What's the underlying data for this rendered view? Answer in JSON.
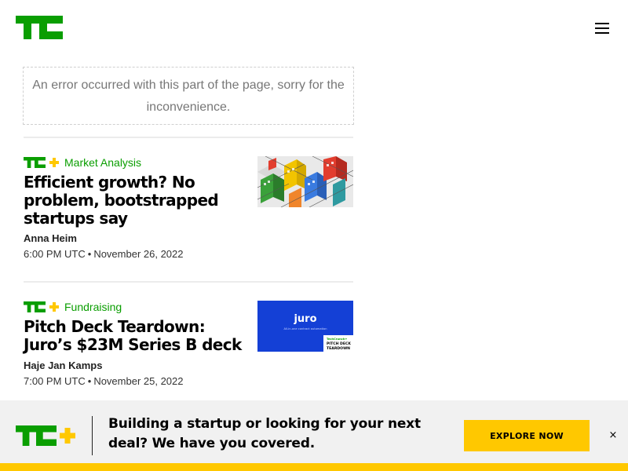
{
  "header": {
    "logo_text": "TC",
    "menu_icon": "hamburger-menu-icon"
  },
  "error_message": "An error occurred with this part of the page, sorry for the inconvenience.",
  "articles": [
    {
      "category": "Market Analysis",
      "title": "Efficient growth? No problem, bootstrapped startups say",
      "author": "Anna Heim",
      "time": "6:00 PM UTC",
      "separator": "•",
      "date": "November 26, 2022"
    },
    {
      "category": "Fundraising",
      "title": "Pitch Deck Teardown: Juro’s $23M Series B deck",
      "author": "Haje Jan Kamps",
      "time": "7:00 PM UTC",
      "separator": "•",
      "date": "November 25, 2022",
      "thumb_text": {
        "brand": "juro",
        "tagline": "All-in-one contract automation",
        "badge_top": "TechCrunch+",
        "badge_line1": "PITCH DECK",
        "badge_line2": "TEARDOWN"
      }
    }
  ],
  "banner": {
    "text": "Building a startup or looking for your next deal? We have you covered.",
    "button_label": "EXPLORE NOW",
    "close_label": "×"
  },
  "colors": {
    "brand_green": "#0a9e01",
    "accent_yellow": "#ffc800",
    "plus_yellow": "#ffc800",
    "juro_blue": "#1440d6"
  }
}
